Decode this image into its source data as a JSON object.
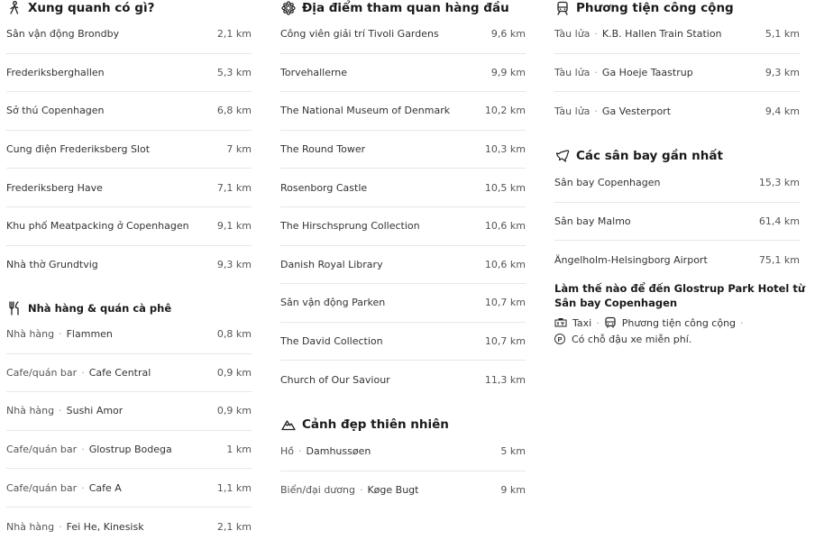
{
  "nearby": {
    "title": "Xung quanh có gì?",
    "items": [
      {
        "name": "Sân vận động Brondby",
        "dist": "2,1 km"
      },
      {
        "name": "Frederiksberghallen",
        "dist": "5,3 km"
      },
      {
        "name": "Sở thú Copenhagen",
        "dist": "6,8 km"
      },
      {
        "name": "Cung điện Frederiksberg Slot",
        "dist": "7 km"
      },
      {
        "name": "Frederiksberg Have",
        "dist": "7,1 km"
      },
      {
        "name": "Khu phố Meatpacking ở Copenhagen",
        "dist": "9,1 km"
      },
      {
        "name": "Nhà thờ Grundtvig",
        "dist": "9,3 km"
      }
    ]
  },
  "restaurants": {
    "title": "Nhà hàng & quán cà phê",
    "items": [
      {
        "cat": "Nhà hàng",
        "name": "Flammen",
        "dist": "0,8 km"
      },
      {
        "cat": "Cafe/quán bar",
        "name": "Cafe Central",
        "dist": "0,9 km"
      },
      {
        "cat": "Nhà hàng",
        "name": "Sushi Amor",
        "dist": "0,9 km"
      },
      {
        "cat": "Cafe/quán bar",
        "name": "Glostrup Bodega",
        "dist": "1 km"
      },
      {
        "cat": "Cafe/quán bar",
        "name": "Cafe A",
        "dist": "1,1 km"
      },
      {
        "cat": "Nhà hàng",
        "name": "Fei He, Kinesisk",
        "dist": "2,1 km"
      }
    ]
  },
  "attractions": {
    "title": "Địa điểm tham quan hàng đầu",
    "items": [
      {
        "name": "Công viên giải trí Tivoli Gardens",
        "dist": "9,6 km"
      },
      {
        "name": "Torvehallerne",
        "dist": "9,9 km"
      },
      {
        "name": "The National Museum of Denmark",
        "dist": "10,2 km"
      },
      {
        "name": "The Round Tower",
        "dist": "10,3 km"
      },
      {
        "name": "Rosenborg Castle",
        "dist": "10,5 km"
      },
      {
        "name": "The Hirschsprung Collection",
        "dist": "10,6 km"
      },
      {
        "name": "Danish Royal Library",
        "dist": "10,6 km"
      },
      {
        "name": "Sân vận động Parken",
        "dist": "10,7 km"
      },
      {
        "name": "The David Collection",
        "dist": "10,7 km"
      },
      {
        "name": "Church of Our Saviour",
        "dist": "11,3 km"
      }
    ]
  },
  "nature": {
    "title": "Cảnh đẹp thiên nhiên",
    "items": [
      {
        "cat": "Hồ",
        "name": "Damhussøen",
        "dist": "5 km"
      },
      {
        "cat": "Biển/đại dương",
        "name": "Køge Bugt",
        "dist": "9 km"
      }
    ]
  },
  "transit": {
    "title": "Phương tiện công cộng",
    "items": [
      {
        "cat": "Tàu lửa",
        "name": "K.B. Hallen Train Station",
        "dist": "5,1 km"
      },
      {
        "cat": "Tàu lửa",
        "name": "Ga Hoeje Taastrup",
        "dist": "9,3 km"
      },
      {
        "cat": "Tàu lửa",
        "name": "Ga Vesterport",
        "dist": "9,4 km"
      }
    ]
  },
  "airports": {
    "title": "Các sân bay gần nhất",
    "items": [
      {
        "name": "Sân bay Copenhagen",
        "dist": "15,3 km"
      },
      {
        "name": "Sân bay Malmo",
        "dist": "61,4 km"
      },
      {
        "name": "Ängelholm-Helsingborg Airport",
        "dist": "75,1 km"
      }
    ]
  },
  "directions": {
    "title": "Làm thế nào để đến Glostrup Park Hotel từ Sân bay Copenhagen",
    "taxi": "Taxi",
    "public": "Phương tiện công cộng",
    "parking": "Có chỗ đậu xe miễn phí."
  },
  "icons": {
    "nearby": "walking-person-icon",
    "restaurants": "fork-knife-icon",
    "attractions": "attraction-icon",
    "nature": "mountain-icon",
    "transit": "train-icon",
    "airports": "airplane-icon",
    "taxi": "taxi-icon",
    "bus": "bus-icon",
    "parking": "parking-icon"
  }
}
